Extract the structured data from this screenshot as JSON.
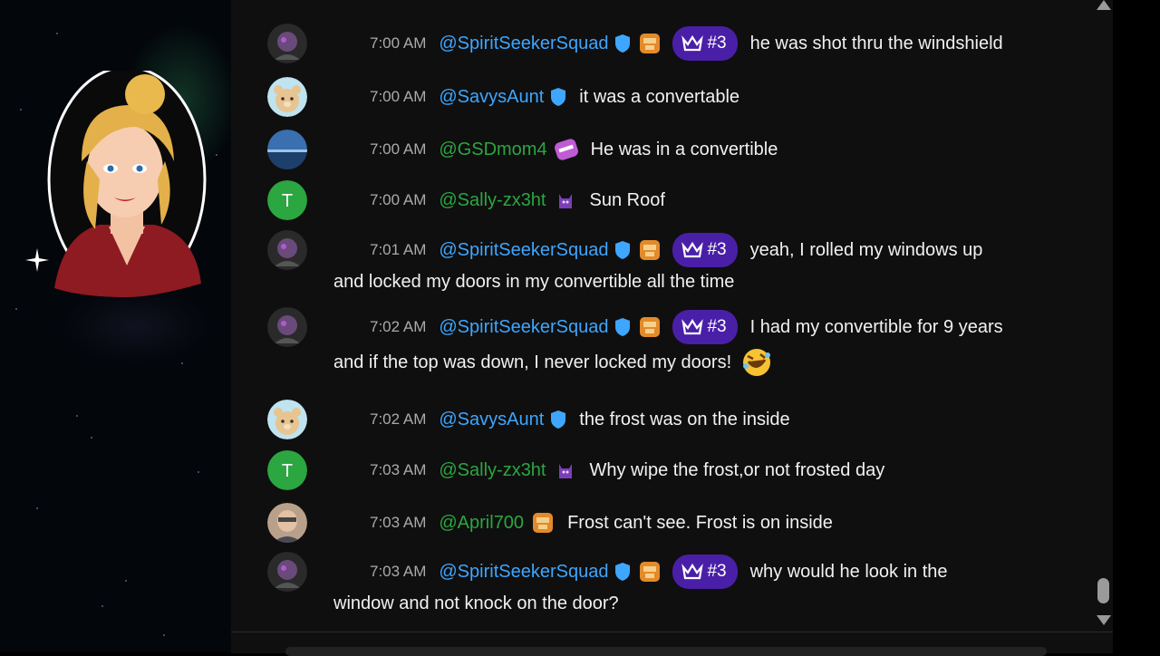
{
  "chat": {
    "messages": [
      {
        "time": "7:00 AM",
        "user": "@SpiritSeekerSquad",
        "user_color": "#3ea6ff",
        "verified": true,
        "member_badge": true,
        "rank": "#3",
        "text": "he was shot thru the windshield",
        "avatar": "spirit"
      },
      {
        "time": "7:00 AM",
        "user": "@SavysAunt",
        "user_color": "#3ea6ff",
        "verified": true,
        "text": "it was a convertable",
        "avatar": "bear"
      },
      {
        "time": "7:00 AM",
        "user": "@GSDmom4",
        "user_color": "#2ba640",
        "sticker_badge": true,
        "text": "He was in a convertible",
        "avatar": "sea"
      },
      {
        "time": "7:00 AM",
        "user": "@Sally-zx3ht",
        "user_color": "#2ba640",
        "purple_badge": true,
        "text": "Sun Roof",
        "avatar": "T"
      },
      {
        "time": "7:01 AM",
        "user": "@SpiritSeekerSquad",
        "user_color": "#3ea6ff",
        "verified": true,
        "member_badge": true,
        "rank": "#3",
        "text": "yeah, I rolled my windows up",
        "text2": "and locked my doors in my convertible all the time",
        "avatar": "spirit"
      },
      {
        "time": "7:02 AM",
        "user": "@SpiritSeekerSquad",
        "user_color": "#3ea6ff",
        "verified": true,
        "member_badge": true,
        "rank": "#3",
        "text": "I had my convertible for 9 years",
        "text2": "and if the top was down, I never locked my doors!",
        "avatar": "spirit",
        "emoji": "rofl"
      },
      {
        "time": "7:02 AM",
        "user": "@SavysAunt",
        "user_color": "#3ea6ff",
        "verified": true,
        "text": "the frost was on the inside",
        "avatar": "bear"
      },
      {
        "time": "7:03 AM",
        "user": "@Sally-zx3ht",
        "user_color": "#2ba640",
        "purple_badge": true,
        "text": "Why wipe the frost,or not frosted day",
        "avatar": "T"
      },
      {
        "time": "7:03 AM",
        "user": "@April700",
        "user_color": "#2ba640",
        "member_badge": true,
        "text": "Frost can't see. Frost is on inside",
        "avatar": "photo"
      },
      {
        "time": "7:03 AM",
        "user": "@SpiritSeekerSquad",
        "user_color": "#3ea6ff",
        "verified": true,
        "member_badge": true,
        "rank": "#3",
        "text": "why would he look in the",
        "text2": "window and not knock on the door?",
        "avatar": "spirit"
      }
    ],
    "avatar_letter": "T"
  },
  "colors": {
    "accent": "#3ea6ff",
    "green": "#2ba640",
    "rank_bg": "#4a1fa8",
    "panel_bg": "#0f0f0f"
  }
}
